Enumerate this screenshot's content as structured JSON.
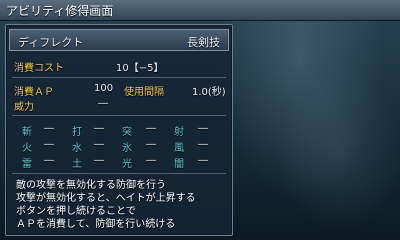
{
  "window": {
    "title": "アビリティ修得画面"
  },
  "skill": {
    "name": "ディフレクト",
    "type": "長剣技"
  },
  "stats": {
    "cost_label": "消費コスト",
    "cost_value": "10【−5】",
    "ap_label": "消費ＡＰ",
    "ap_value": "100",
    "interval_label": "使用間隔",
    "interval_value": "1.0(秒)",
    "power_label": "威力",
    "power_value": "―"
  },
  "elements": [
    [
      {
        "name": "斬",
        "value": "―"
      },
      {
        "name": "打",
        "value": "―"
      },
      {
        "name": "突",
        "value": "―"
      },
      {
        "name": "射",
        "value": "―"
      }
    ],
    [
      {
        "name": "火",
        "value": "―"
      },
      {
        "name": "水",
        "value": "―"
      },
      {
        "name": "氷",
        "value": "―"
      },
      {
        "name": "風",
        "value": "―"
      }
    ],
    [
      {
        "name": "雷",
        "value": "―"
      },
      {
        "name": "土",
        "value": "―"
      },
      {
        "name": "光",
        "value": "―"
      },
      {
        "name": "闇",
        "value": "―"
      }
    ]
  ],
  "description": [
    "敵の攻撃を無効化する防御を行う",
    "攻撃が無効化すると、ヘイトが上昇する",
    "ボタンを押し続けることで",
    "ＡＰを消費して、防御を行い続ける"
  ],
  "colors": {
    "label": "#f2c45a",
    "element": "#5fc5d0",
    "text": "#e8edf2"
  }
}
